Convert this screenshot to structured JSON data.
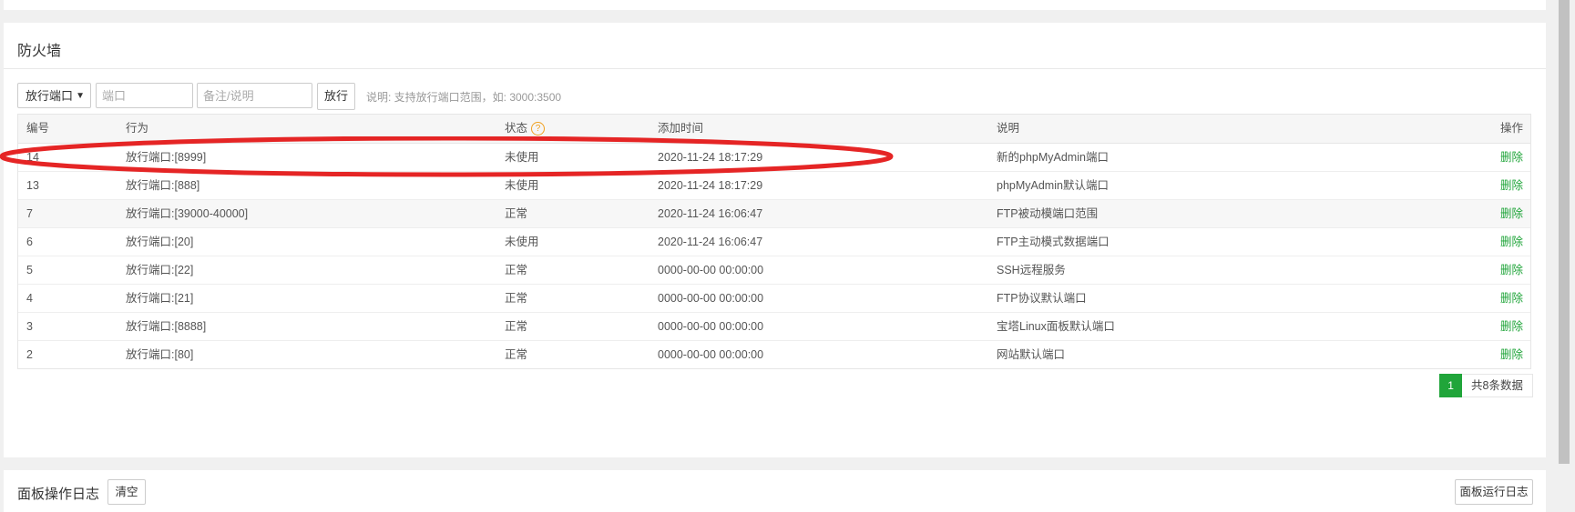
{
  "firewall": {
    "title": "防火墙",
    "toolbar": {
      "select_value": "放行端口",
      "port_placeholder": "端口",
      "note_placeholder": "备注/说明",
      "allow_button": "放行",
      "hint": "说明: 支持放行端口范围，如: 3000:3500"
    },
    "columns": {
      "id": "编号",
      "action": "行为",
      "status": "状态",
      "status_help": "?",
      "time": "添加时间",
      "desc": "说明",
      "op": "操作"
    },
    "rows": [
      {
        "id": "14",
        "action": "放行端口:[8999]",
        "status": "未使用",
        "time": "2020-11-24 18:17:29",
        "desc": "新的phpMyAdmin端口",
        "op": "删除"
      },
      {
        "id": "13",
        "action": "放行端口:[888]",
        "status": "未使用",
        "time": "2020-11-24 18:17:29",
        "desc": "phpMyAdmin默认端口",
        "op": "删除"
      },
      {
        "id": "7",
        "action": "放行端口:[39000-40000]",
        "status": "正常",
        "time": "2020-11-24 16:06:47",
        "desc": "FTP被动模端口范围",
        "op": "删除"
      },
      {
        "id": "6",
        "action": "放行端口:[20]",
        "status": "未使用",
        "time": "2020-11-24 16:06:47",
        "desc": "FTP主动模式数据端口",
        "op": "删除"
      },
      {
        "id": "5",
        "action": "放行端口:[22]",
        "status": "正常",
        "time": "0000-00-00 00:00:00",
        "desc": "SSH远程服务",
        "op": "删除"
      },
      {
        "id": "4",
        "action": "放行端口:[21]",
        "status": "正常",
        "time": "0000-00-00 00:00:00",
        "desc": "FTP协议默认端口",
        "op": "删除"
      },
      {
        "id": "3",
        "action": "放行端口:[8888]",
        "status": "正常",
        "time": "0000-00-00 00:00:00",
        "desc": "宝塔Linux面板默认端口",
        "op": "删除"
      },
      {
        "id": "2",
        "action": "放行端口:[80]",
        "status": "正常",
        "time": "0000-00-00 00:00:00",
        "desc": "网站默认端口",
        "op": "删除"
      }
    ],
    "pager": {
      "current": "1",
      "total": "共8条数据"
    }
  },
  "log_panel": {
    "title": "面板操作日志",
    "clear_button": "清空",
    "run_log_button": "面板运行日志"
  },
  "colors": {
    "accent_green": "#20a53a",
    "annotation_red": "#e52525",
    "help_orange": "#f0a020"
  }
}
